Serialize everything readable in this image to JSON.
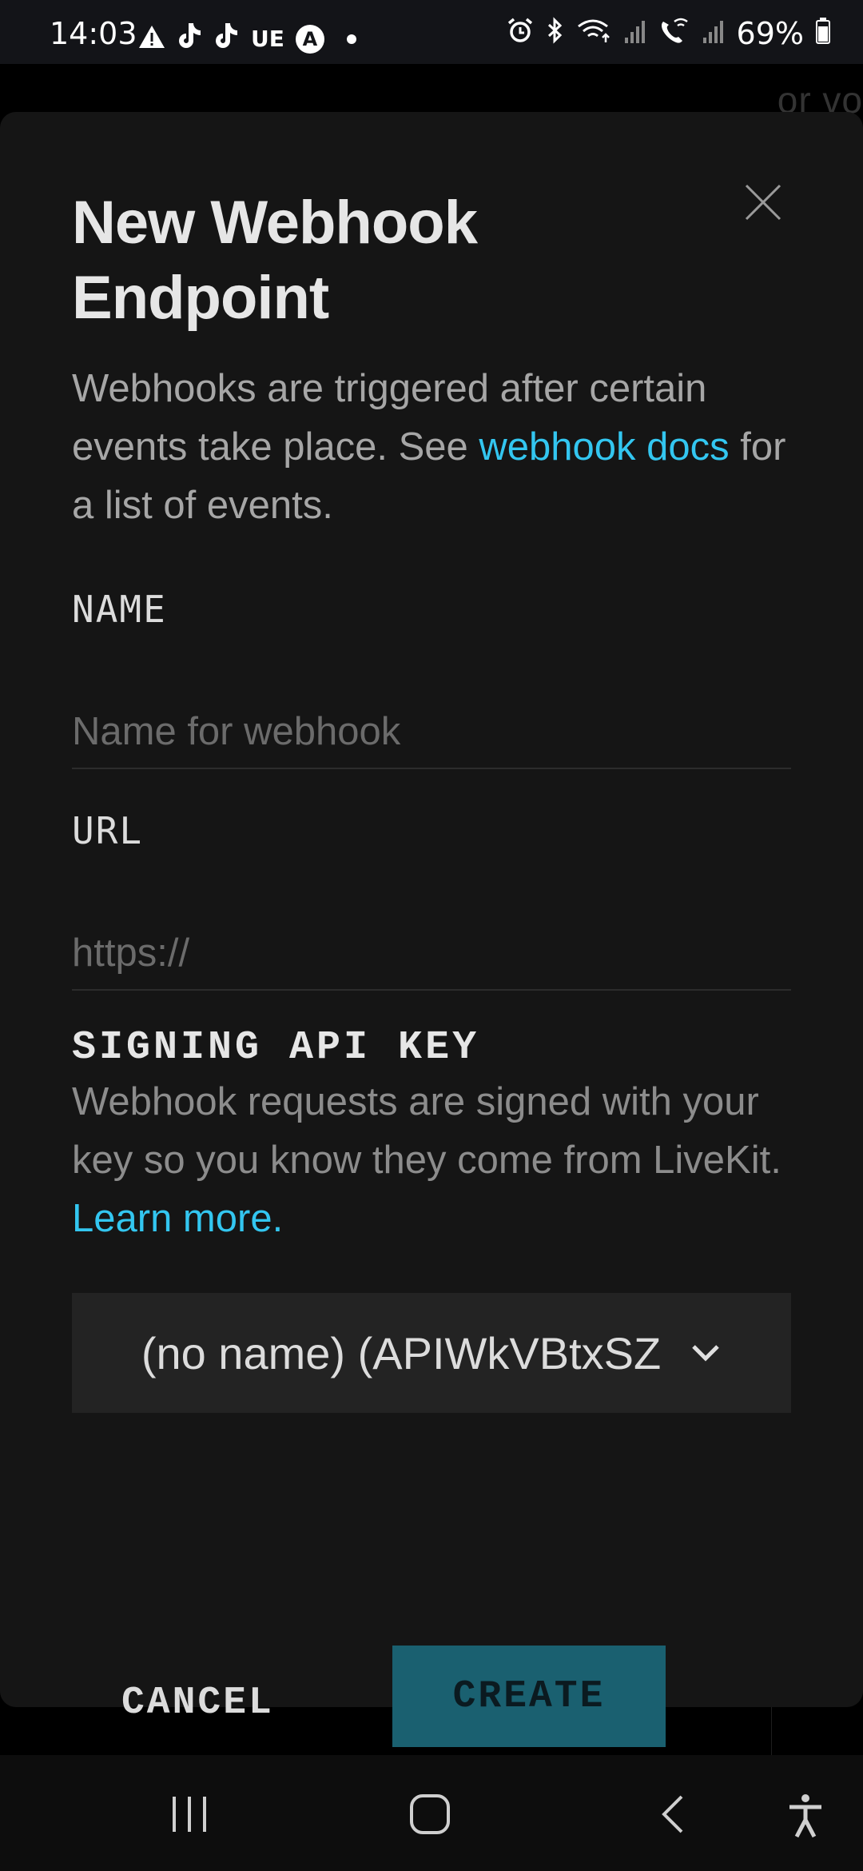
{
  "status_bar": {
    "time": "14:03",
    "left_icons": [
      "alert-icon",
      "tiktok-icon",
      "tiktok-icon",
      "ue-label",
      "a-circle-icon",
      "dot-icon"
    ],
    "ue_text": "UE",
    "a_text": "A",
    "right_icons": [
      "alarm-icon",
      "bluetooth-icon",
      "wifi-icon",
      "signal-icon",
      "wifi-call-icon",
      "signal-icon",
      "battery-icon"
    ],
    "battery": "69%"
  },
  "background": {
    "partial_text": "or vo"
  },
  "dialog": {
    "title_line1": "New Webhook",
    "title_line2": "Endpoint",
    "description_pre": "Webhooks are triggered after certain events take place. See ",
    "description_link": "webhook docs",
    "description_post": " for a list of events.",
    "name_label": "NAME",
    "name_placeholder": "Name for webhook",
    "name_value": "",
    "url_label": "URL",
    "url_placeholder": "https://",
    "url_value": "",
    "signing_label": "SIGNING API KEY",
    "signing_desc_pre": "Webhook requests are signed with your key so you know they come from LiveKit. ",
    "signing_link": "Learn more.",
    "api_key_selected": "(no name) (APIWkVBtxSZ",
    "cancel_label": "CANCEL",
    "create_label": "CREATE"
  },
  "colors": {
    "accent_link": "#33c6f0",
    "create_button": "#1a6070",
    "dialog_bg": "#151515"
  }
}
